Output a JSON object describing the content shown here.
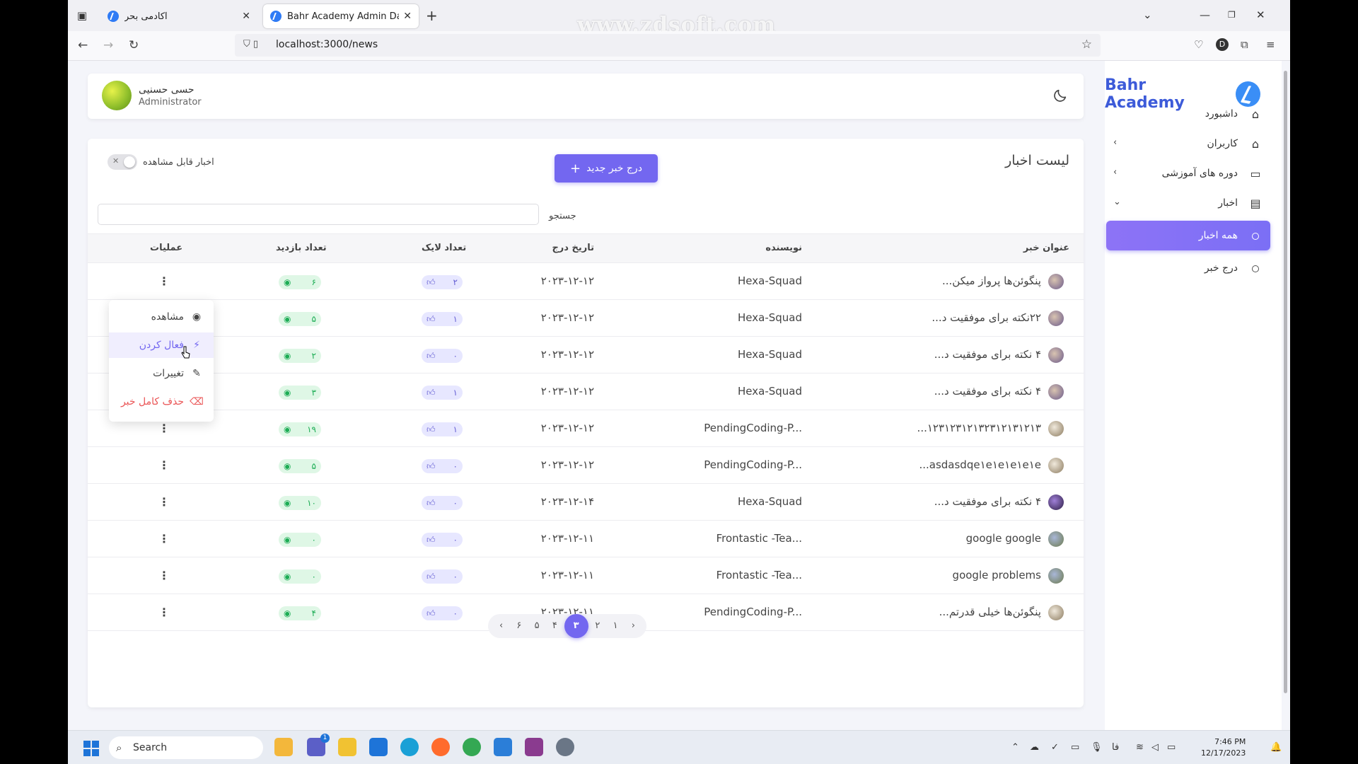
{
  "browser": {
    "tabs": [
      {
        "label": "آکادمی بحر",
        "close": "✕"
      },
      {
        "label": "Bahr Academy Admin Dashboa",
        "close": "✕"
      }
    ],
    "new_tab": "+",
    "watermark": "www.zdsoft.com",
    "url": "localhost:3000/news",
    "profile_initial": "D"
  },
  "header": {
    "user_name": "حسی حسنیی",
    "user_role": "Administrator"
  },
  "sidebar": {
    "brand": "Bahr Academy",
    "items": [
      {
        "label": "داشبورد",
        "icon": "home-icon"
      },
      {
        "label": "کاربران",
        "icon": "home-icon"
      },
      {
        "label": "دوره های آموزشی",
        "icon": "monitor-icon"
      },
      {
        "label": "اخبار",
        "icon": "document-icon"
      },
      {
        "label": "همه اخبار",
        "icon": "circle-icon"
      },
      {
        "label": "درج خبر",
        "icon": "circle-icon"
      }
    ]
  },
  "main": {
    "title": "لیست اخبار",
    "add_button": "درج خبر جدید",
    "toggle_label": "اخبار قابل مشاهده",
    "search_label": "جستجو",
    "search_value": "",
    "columns": [
      "عنوان خبر",
      "نویسنده",
      "تاریخ درج",
      "تعداد لایک",
      "تعداد بازدید",
      "عملیات"
    ],
    "rows": [
      {
        "title": "پنگوئن‌ها پرواز میکن...",
        "author": "Hexa-Squad",
        "date": "۲۰۲۳-۱۲-۱۲",
        "likes": "۲",
        "views": "۶"
      },
      {
        "title": "۲۲نکته برای موفقیت د...",
        "author": "Hexa-Squad",
        "date": "۲۰۲۳-۱۲-۱۲",
        "likes": "۱",
        "views": "۵"
      },
      {
        "title": "۴ نکته برای موفقیت د...",
        "author": "Hexa-Squad",
        "date": "۲۰۲۳-۱۲-۱۲",
        "likes": "۰",
        "views": "۲"
      },
      {
        "title": "۴ نکته برای موفقیت د...",
        "author": "Hexa-Squad",
        "date": "۲۰۲۳-۱۲-۱۲",
        "likes": "۱",
        "views": "۳"
      },
      {
        "title": "۱۲۳۱۲۳۱۲۱۳۲۳۱۲۱۳۱۲۱۳...",
        "author": "PendingCoding-P...",
        "date": "۲۰۲۳-۱۲-۱۲",
        "likes": "۱",
        "views": "۱۹"
      },
      {
        "title": "asdasdqe١e١e١e١e١e...",
        "author": "PendingCoding-P...",
        "date": "۲۰۲۳-۱۲-۱۲",
        "likes": "۰",
        "views": "۵"
      },
      {
        "title": "۴ نکته برای موفقیت د...",
        "author": "Hexa-Squad",
        "date": "۲۰۲۳-۱۲-۱۴",
        "likes": "۰",
        "views": "۱۰"
      },
      {
        "title": "google google",
        "author": "Frontastic -Tea...",
        "date": "۲۰۲۳-۱۲-۱۱",
        "likes": "۰",
        "views": "۰"
      },
      {
        "title": "google problems",
        "author": "Frontastic -Tea...",
        "date": "۲۰۲۳-۱۲-۱۱",
        "likes": "۰",
        "views": "۰"
      },
      {
        "title": "پنگوئن‌ها خیلی قدرتم...",
        "author": "PendingCoding-P...",
        "date": "۲۰۲۳-۱۲-۱۱",
        "likes": "۰",
        "views": "۴"
      }
    ],
    "action_menu": [
      {
        "label": "مشاهده",
        "icon": "eye-icon"
      },
      {
        "label": "فعال کردن",
        "icon": "activate-icon"
      },
      {
        "label": "تغییرات",
        "icon": "edit-icon"
      },
      {
        "label": "حذف کامل خبر",
        "icon": "delete-icon"
      }
    ],
    "pagination": {
      "prev": "‹",
      "pages": [
        "۶",
        "۵",
        "۴",
        "۳",
        "۲",
        "۱"
      ],
      "current": "۳",
      "next": "›"
    }
  },
  "taskbar": {
    "search": "Search",
    "time": "7:46 PM",
    "date": "12/17/2023",
    "lang": "فا",
    "chat_badge": "1"
  },
  "colors": {
    "accent": "#7367f0",
    "brand": "#3d5bd9",
    "danger": "#ea5455",
    "success": "#1dad55"
  }
}
